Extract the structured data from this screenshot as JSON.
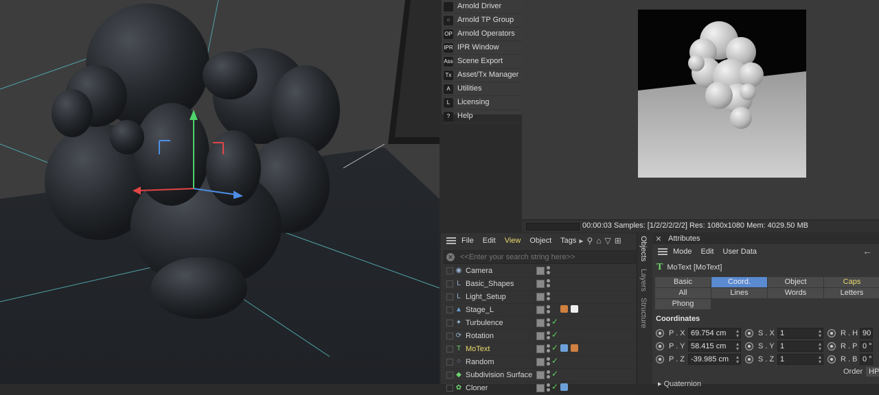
{
  "arnold_menu": {
    "items": [
      {
        "icon": "document-icon",
        "glyph": "",
        "label": "Arnold Driver"
      },
      {
        "icon": "tp-group-icon",
        "glyph": "⁘",
        "label": "Arnold TP Group"
      },
      {
        "icon": "op-icon",
        "glyph": "OP",
        "label": "Arnold Operators"
      },
      {
        "icon": "ipr-icon",
        "glyph": "IPR",
        "label": "IPR Window"
      },
      {
        "icon": "ass-icon",
        "glyph": "Ass",
        "label": "Scene Export"
      },
      {
        "icon": "tx-icon",
        "glyph": "Tx",
        "label": "Asset/Tx Manager"
      },
      {
        "icon": "utilities-icon",
        "glyph": "A",
        "label": "Utilities"
      },
      {
        "icon": "licensing-icon",
        "glyph": "L",
        "label": "Licensing"
      },
      {
        "icon": "help-icon",
        "glyph": "?",
        "label": "Help"
      }
    ]
  },
  "ipr": {
    "status": "00:00:03  Samples: [1/2/2/2/2/2]  Res: 1080x1080  Mem: 4029.50 MB"
  },
  "object_manager": {
    "menus": [
      "File",
      "Edit",
      "View",
      "Object",
      "Tags"
    ],
    "highlighted_menu": "View",
    "search_placeholder": "<<Enter your search string here>>",
    "side_tabs": [
      "Objects",
      "Layers",
      "Structure"
    ],
    "objects": [
      {
        "name": "Camera",
        "icon": "camera-icon",
        "glyph": "◉",
        "color": "#9bb8d8",
        "check": false,
        "selected": false
      },
      {
        "name": "Basic_Shapes",
        "icon": "null-object-icon",
        "glyph": "L",
        "color": "#9bb8d8",
        "check": false,
        "selected": false
      },
      {
        "name": "Light_Setup",
        "icon": "null-object-icon",
        "glyph": "L",
        "color": "#9bb8d8",
        "check": false,
        "selected": false
      },
      {
        "name": "Stage_L",
        "icon": "stage-icon",
        "glyph": "▲",
        "color": "#6ca0d8",
        "check": false,
        "selected": false
      },
      {
        "name": "Turbulence",
        "icon": "turbulence-icon",
        "glyph": "✦",
        "color": "#9bb8d8",
        "check": true,
        "selected": false
      },
      {
        "name": "Rotation",
        "icon": "rotation-icon",
        "glyph": "⟳",
        "color": "#9bb8d8",
        "check": true,
        "selected": false
      },
      {
        "name": "MoText",
        "icon": "motext-icon",
        "glyph": "T",
        "color": "#6fd86f",
        "check": true,
        "selected": true
      },
      {
        "name": "Random",
        "icon": "random-icon",
        "glyph": "⁘",
        "color": "#9bb8d8",
        "check": true,
        "selected": false
      },
      {
        "name": "Subdivision Surface",
        "icon": "subdivision-icon",
        "glyph": "◆",
        "color": "#6fd86f",
        "check": true,
        "selected": false
      },
      {
        "name": "Cloner",
        "icon": "cloner-icon",
        "glyph": "✿",
        "color": "#6fd86f",
        "check": true,
        "selected": false
      }
    ]
  },
  "attributes": {
    "title": "Attributes",
    "menus": [
      "Mode",
      "Edit",
      "User Data"
    ],
    "object_label": "MoText [MoText]",
    "tabs_row1": [
      "Basic",
      "Coord.",
      "Object",
      "Caps"
    ],
    "tabs_row2": [
      "All",
      "Lines",
      "Words",
      "Letters"
    ],
    "tabs_row3": [
      "Phong"
    ],
    "active_tab": "Coord.",
    "section": "Coordinates",
    "position": [
      {
        "label": "P . X",
        "value": "69.754 cm"
      },
      {
        "label": "P . Y",
        "value": "58.415 cm"
      },
      {
        "label": "P . Z",
        "value": "-39.985 cm"
      }
    ],
    "scale": [
      {
        "label": "S . X",
        "value": "1"
      },
      {
        "label": "S . Y",
        "value": "1"
      },
      {
        "label": "S . Z",
        "value": "1"
      }
    ],
    "rotation": [
      {
        "label": "R . H",
        "value": "90"
      },
      {
        "label": "R . P",
        "value": "0 °"
      },
      {
        "label": "R . B",
        "value": "0 °"
      }
    ],
    "order_label": "Order",
    "order_value": "HP",
    "quaternion_label": "▸ Quaternion"
  },
  "colors": {
    "accent_blue": "#5a8ad0",
    "highlight_yellow": "#e7d86b",
    "check_green": "#5fd35f"
  }
}
